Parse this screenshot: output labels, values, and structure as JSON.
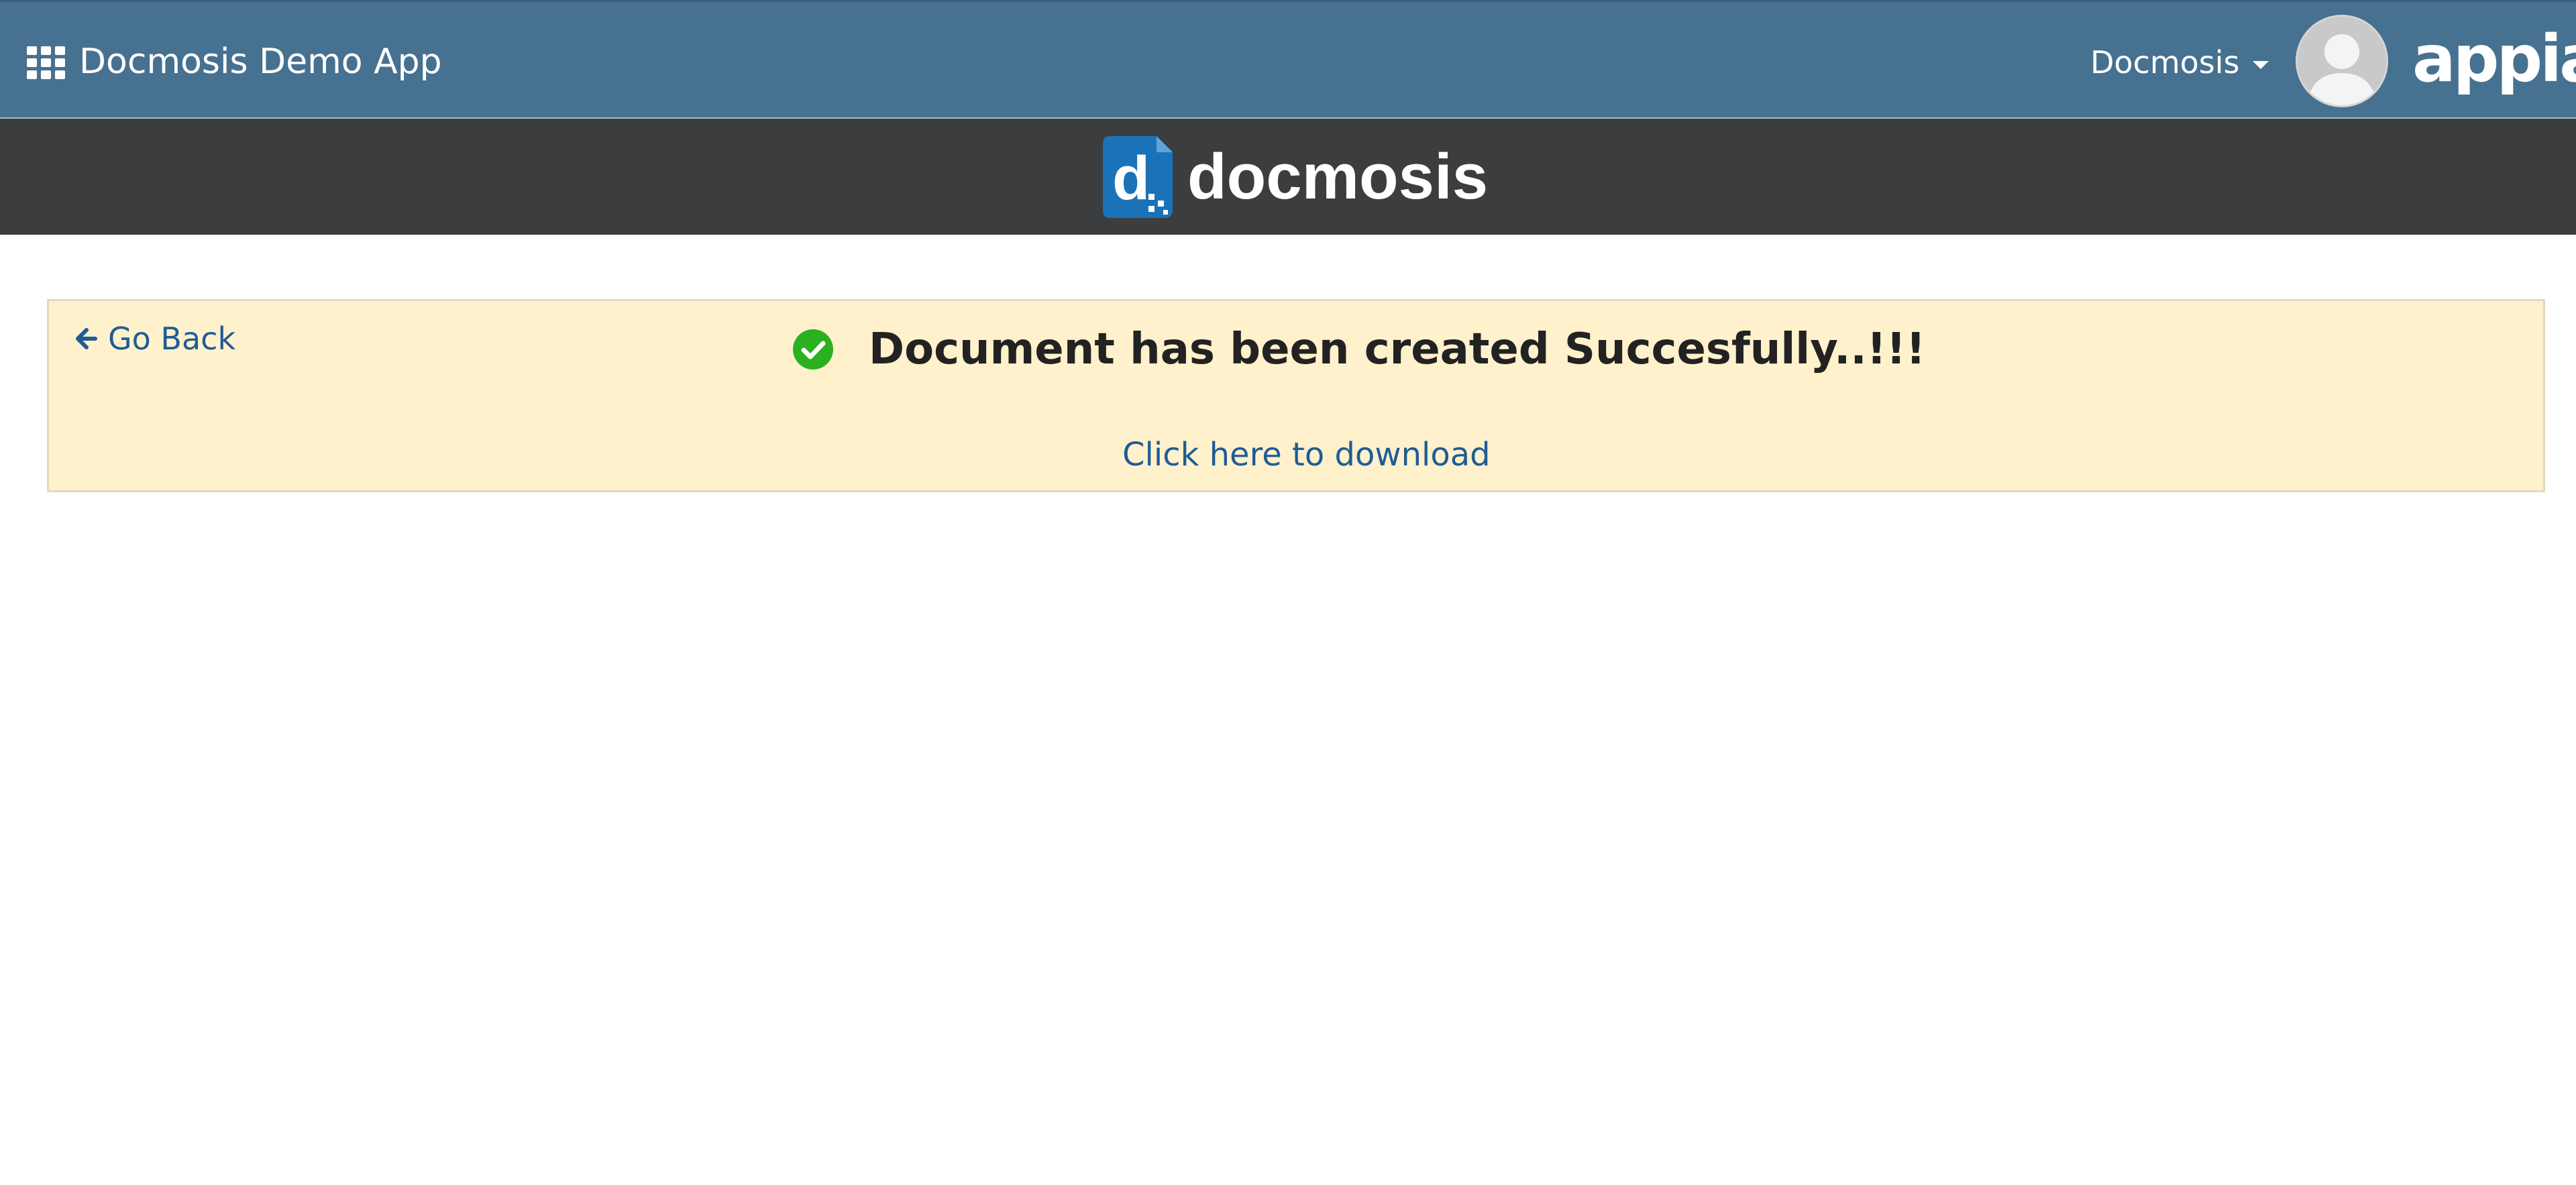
{
  "header": {
    "app_title": "Docmosis Demo App",
    "user_menu_label": "Docmosis",
    "brand": "appian",
    "menu_icon": "grid-icon",
    "avatar_icon": "user-avatar-icon",
    "background_color": "#467190"
  },
  "banner": {
    "wordmark": "docmosis",
    "logo_letter": "d",
    "logo_color": "#1a73b8",
    "background_color": "#3c3d3f"
  },
  "panel": {
    "go_back_label": "Go Back",
    "success_message": "Document has been created Succesfully..!!!",
    "download_label": "Click here to download",
    "status_color": "#2bb11f",
    "background_color": "#fef1cc",
    "link_color": "#1f5c94"
  }
}
